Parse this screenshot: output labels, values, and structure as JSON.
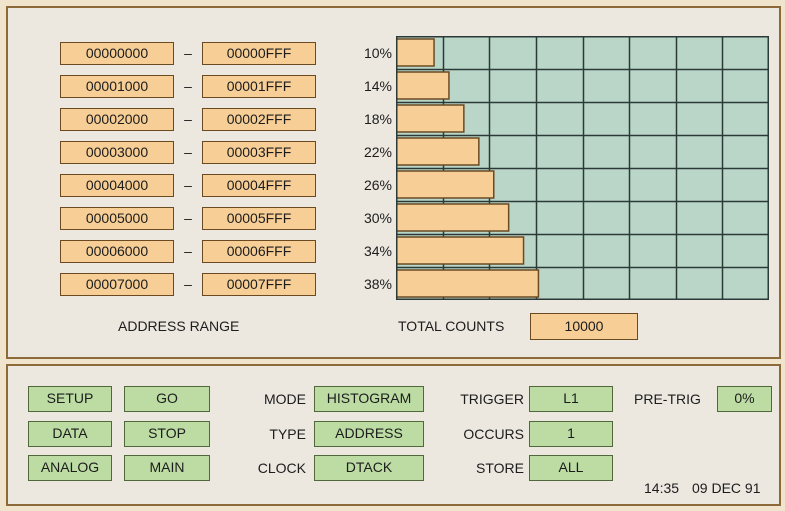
{
  "ranges": [
    {
      "start": "00000000",
      "end": "00000FFF",
      "percent": "10%",
      "fraction": 0.1
    },
    {
      "start": "00001000",
      "end": "00001FFF",
      "percent": "14%",
      "fraction": 0.14
    },
    {
      "start": "00002000",
      "end": "00002FFF",
      "percent": "18%",
      "fraction": 0.18
    },
    {
      "start": "00003000",
      "end": "00003FFF",
      "percent": "22%",
      "fraction": 0.22
    },
    {
      "start": "00004000",
      "end": "00004FFF",
      "percent": "26%",
      "fraction": 0.26
    },
    {
      "start": "00005000",
      "end": "00005FFF",
      "percent": "30%",
      "fraction": 0.3
    },
    {
      "start": "00006000",
      "end": "00006FFF",
      "percent": "34%",
      "fraction": 0.34
    },
    {
      "start": "00007000",
      "end": "00007FFF",
      "percent": "38%",
      "fraction": 0.38
    }
  ],
  "dash": "–",
  "address_range_label": "ADDRESS RANGE",
  "total_counts_label": "TOTAL COUNTS",
  "total_counts_value": "10000",
  "buttons": {
    "setup": "SETUP",
    "go": "GO",
    "data": "DATA",
    "stop": "STOP",
    "analog": "ANALOG",
    "main": "MAIN"
  },
  "settings": {
    "mode_label": "MODE",
    "mode_value": "HISTOGRAM",
    "type_label": "TYPE",
    "type_value": "ADDRESS",
    "clock_label": "CLOCK",
    "clock_value": "DTACK",
    "trigger_label": "TRIGGER",
    "trigger_value": "L1",
    "occurs_label": "OCCURS",
    "occurs_value": "1",
    "store_label": "STORE",
    "store_value": "ALL",
    "pretrig_label": "PRE-TRIG",
    "pretrig_value": "0%"
  },
  "time": "14:35",
  "date": "09 DEC 91",
  "colors": {
    "bar_fill": "#f7cf96",
    "bar_stroke": "#6b4a22",
    "grid_bg": "#b9d6c9",
    "grid_line": "#2b3a36",
    "button_green": "#bcdca4"
  }
}
